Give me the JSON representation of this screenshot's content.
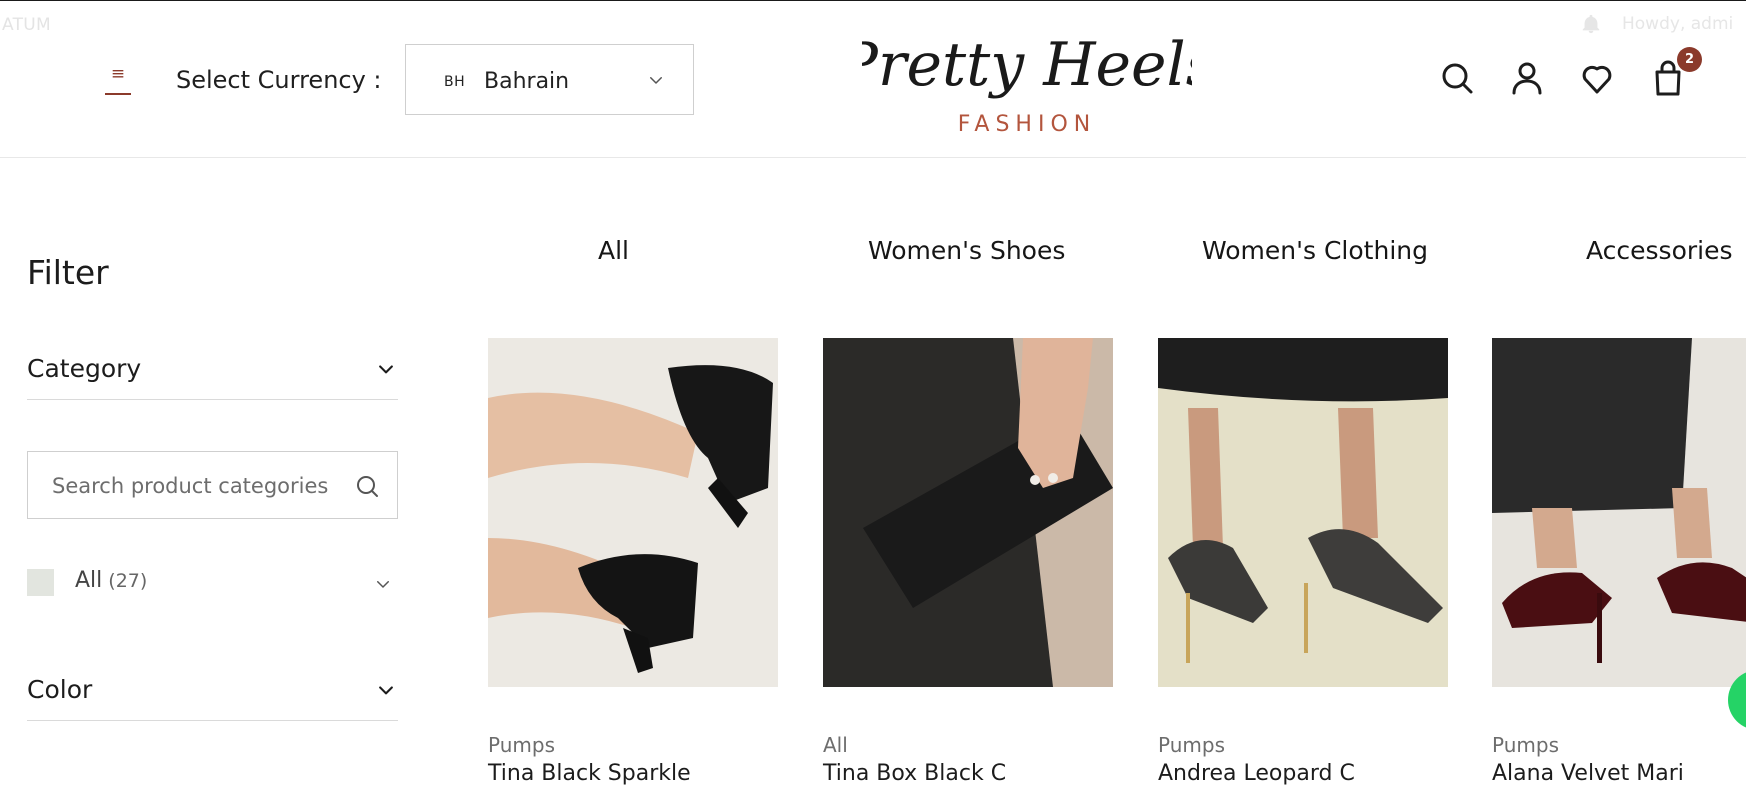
{
  "admin_bar": {
    "left_text": "ATUM",
    "right_text": "Howdy, admi"
  },
  "header": {
    "menu_glyph": "≡",
    "currency_label": "Select Currency :",
    "currency_code": "BH",
    "currency_country": "Bahrain",
    "cart_count": "2",
    "logo_script": "Pretty Heels",
    "logo_sub": "FASHION",
    "accent_color": "#8b3a2b",
    "icons": [
      "menu-icon",
      "chevron-down-icon",
      "search-icon",
      "account-icon",
      "heart-icon",
      "bag-icon"
    ]
  },
  "filter": {
    "title": "Filter",
    "category_label": "Category",
    "search_placeholder": "Search product categories",
    "category_item": {
      "name": "All",
      "count": "(27)"
    },
    "color_label": "Color"
  },
  "tabs": [
    "All",
    "Women's Shoes",
    "Women's Clothing",
    "Accessories"
  ],
  "products": [
    {
      "category": "Pumps",
      "name": "Tina Black Sparkle"
    },
    {
      "category": "All",
      "name": "Tina Box Black C"
    },
    {
      "category": "Pumps",
      "name": "Andrea Leopard C"
    },
    {
      "category": "Pumps",
      "name": "Alana Velvet Mari"
    }
  ]
}
